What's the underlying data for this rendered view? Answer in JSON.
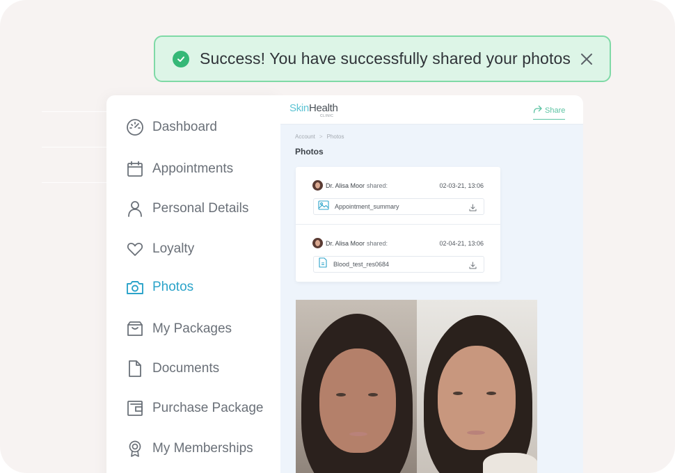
{
  "toast": {
    "message": "Success! You have successfully shared your photos",
    "status_color": "#35b877",
    "icon": "check-circle-icon",
    "close_icon": "close-icon"
  },
  "sidebar": {
    "items": [
      {
        "label": "Dashboard",
        "icon": "speedometer-icon",
        "active": false
      },
      {
        "label": "Appointments",
        "icon": "calendar-icon",
        "active": false
      },
      {
        "label": "Personal Details",
        "icon": "user-icon",
        "active": false
      },
      {
        "label": "Loyalty",
        "icon": "heart-icon",
        "active": false
      },
      {
        "label": "Photos",
        "icon": "camera-icon",
        "active": true
      },
      {
        "label": "My Packages",
        "icon": "package-icon",
        "active": false
      },
      {
        "label": "Documents",
        "icon": "document-icon",
        "active": false
      },
      {
        "label": "Purchase Package",
        "icon": "wallet-icon",
        "active": false
      },
      {
        "label": "My Memberships",
        "icon": "badge-icon",
        "active": false
      }
    ],
    "active_color": "#2ba3c9"
  },
  "app": {
    "logo": {
      "skin": "Skin",
      "health": "Health",
      "clinic": "CLINIC"
    },
    "share_label": "Share",
    "breadcrumb": [
      "Account",
      "Photos"
    ],
    "page_title": "Photos",
    "entries": [
      {
        "author": "Dr. Alisa Moor",
        "action": "shared:",
        "date": "02-03-21, 13:06",
        "file": "Appointment_summary",
        "file_icon": "image-file-icon"
      },
      {
        "author": "Dr. Alisa Moor",
        "action": "shared:",
        "date": "02-04-21, 13:06",
        "file": "Blood_test_res0684",
        "file_icon": "pdf-file-icon"
      }
    ]
  }
}
